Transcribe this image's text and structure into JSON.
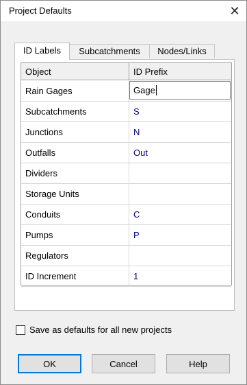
{
  "window": {
    "title": "Project Defaults",
    "close_glyph": "✕"
  },
  "tabs": [
    {
      "label": "ID Labels",
      "active": true
    },
    {
      "label": "Subcatchments",
      "active": false
    },
    {
      "label": "Nodes/Links",
      "active": false
    }
  ],
  "table": {
    "headers": [
      "Object",
      "ID Prefix"
    ],
    "rows": [
      {
        "object": "Rain Gages",
        "prefix": "Gage",
        "editing": true
      },
      {
        "object": "Subcatchments",
        "prefix": "S"
      },
      {
        "object": "Junctions",
        "prefix": "N"
      },
      {
        "object": "Outfalls",
        "prefix": "Out"
      },
      {
        "object": "Dividers",
        "prefix": ""
      },
      {
        "object": "Storage Units",
        "prefix": ""
      },
      {
        "object": "Conduits",
        "prefix": "C"
      },
      {
        "object": "Pumps",
        "prefix": "P"
      },
      {
        "object": "Regulators",
        "prefix": ""
      },
      {
        "object": "ID Increment",
        "prefix": "1"
      }
    ]
  },
  "checkbox": {
    "label": "Save as defaults for all new projects",
    "checked": false
  },
  "buttons": {
    "ok": "OK",
    "cancel": "Cancel",
    "help": "Help"
  },
  "colors": {
    "accent": "#0078d7",
    "value_text": "#00007a"
  }
}
